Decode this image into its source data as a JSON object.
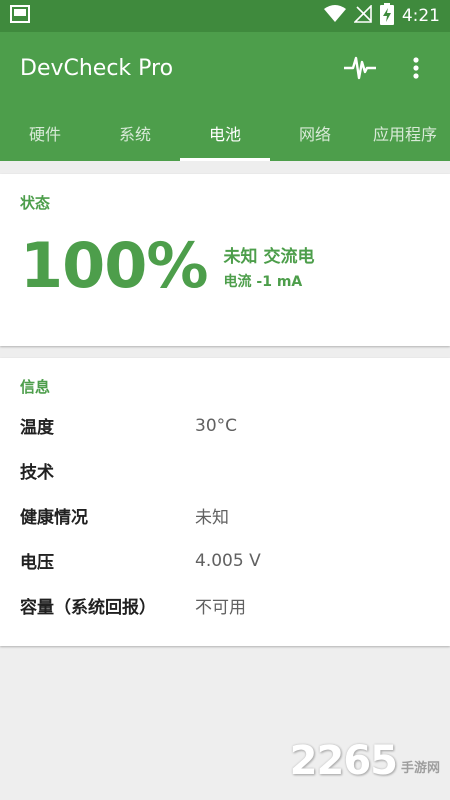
{
  "status_bar": {
    "time": "4:21",
    "icons": [
      "gallery-icon",
      "wifi-icon",
      "no-signal-icon",
      "battery-charging-icon"
    ]
  },
  "app": {
    "title": "DevCheck Pro",
    "actions": [
      "pulse-icon",
      "more-vert-icon"
    ]
  },
  "tabs": [
    {
      "label": "硬件"
    },
    {
      "label": "系统"
    },
    {
      "label": "电池",
      "active": true
    },
    {
      "label": "网络"
    },
    {
      "label": "应用程序"
    }
  ],
  "status_section": {
    "title": "状态",
    "level": "100%",
    "state": "未知 交流电",
    "current": "电流 -1 mA"
  },
  "info_section": {
    "title": "信息",
    "rows": [
      {
        "label": "温度",
        "value": "30°C"
      },
      {
        "label": "技术",
        "value": ""
      },
      {
        "label": "健康情况",
        "value": "未知"
      },
      {
        "label": "电压",
        "value": "4.005 V"
      },
      {
        "label": "容量（系统回报）",
        "value": "不可用"
      }
    ]
  },
  "watermark": {
    "number": "2265",
    "text": "手游网"
  },
  "colors": {
    "accent": "#4d9e4b",
    "status_bar": "#3f8a3d",
    "background": "#eeeeee"
  }
}
